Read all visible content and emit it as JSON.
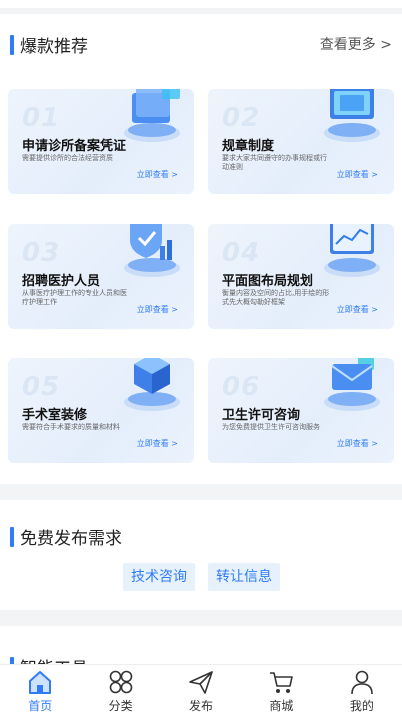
{
  "hot": {
    "title": "爆款推荐",
    "more": "查看更多 >",
    "cards": [
      {
        "num": "01",
        "title": "申请诊所备案凭证",
        "desc": "需要提供诊所的合法经营资质",
        "link": "立即查看 >"
      },
      {
        "num": "02",
        "title": "规章制度",
        "desc": "要求大家共同遵守的办事规程或行动准则",
        "link": "立即查看 >"
      },
      {
        "num": "03",
        "title": "招聘医护人员",
        "desc": "从事医疗护理工作的专业人员和医疗护理工作",
        "link": "立即查看 >"
      },
      {
        "num": "04",
        "title": "平面图布局规划",
        "desc": "衡量内容及空间的占比,用手绘的形式先大概勾勒好框架",
        "link": "立即查看 >"
      },
      {
        "num": "05",
        "title": "手术室装修",
        "desc": "需要符合手术要求的质量和材料",
        "link": "立即查看 >"
      },
      {
        "num": "06",
        "title": "卫生许可咨询",
        "desc": "为您免费提供卫生许可咨询服务",
        "link": "立即查看 >"
      }
    ]
  },
  "free": {
    "title": "免费发布需求",
    "buttons": [
      "技术咨询",
      "转让信息"
    ]
  },
  "tools": {
    "title": "智能工具"
  },
  "tabbar": {
    "items": [
      {
        "label": "首页",
        "icon": "home-icon",
        "active": true
      },
      {
        "label": "分类",
        "icon": "category-icon",
        "active": false
      },
      {
        "label": "发布",
        "icon": "send-icon",
        "active": false
      },
      {
        "label": "商城",
        "icon": "cart-icon",
        "active": false
      },
      {
        "label": "我的",
        "icon": "user-icon",
        "active": false
      }
    ]
  },
  "colors": {
    "accent": "#2f7cf6",
    "card_bg": "#e8f0fc",
    "button_bg": "#e6f1fc"
  }
}
